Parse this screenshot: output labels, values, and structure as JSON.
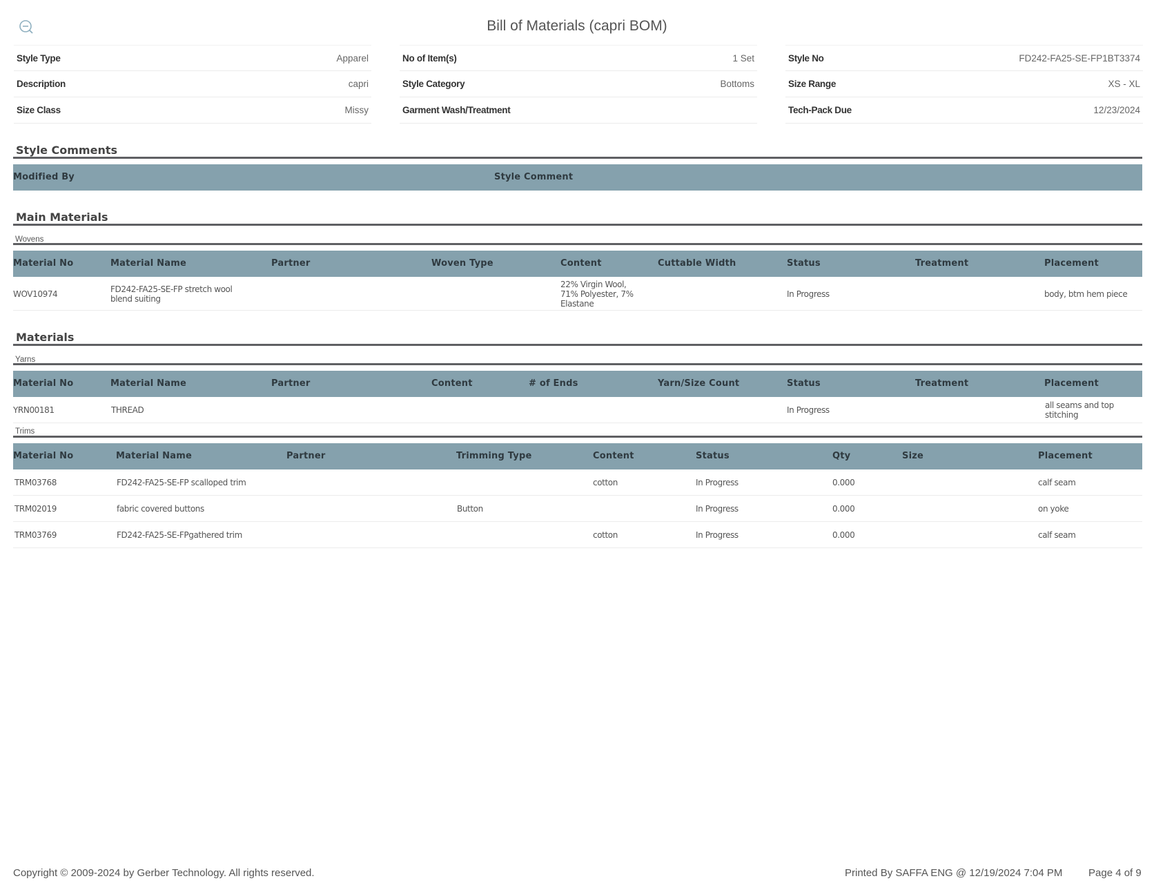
{
  "title": "Bill of Materials (capri BOM)",
  "zoom_icon": "zoom-out-icon",
  "info": [
    [
      {
        "label": "Style Type",
        "value": "Apparel"
      },
      {
        "label": "Description",
        "value": "capri"
      },
      {
        "label": "Size Class",
        "value": "Missy"
      }
    ],
    [
      {
        "label": "No of Item(s)",
        "value": "1 Set"
      },
      {
        "label": "Style Category",
        "value": "Bottoms"
      },
      {
        "label": "Garment Wash/Treatment",
        "value": ""
      }
    ],
    [
      {
        "label": "Style No",
        "value": "FD242-FA25-SE-FP1BT3374"
      },
      {
        "label": "Size Range",
        "value": "XS - XL"
      },
      {
        "label": "Tech-Pack Due",
        "value": "12/23/2024"
      }
    ]
  ],
  "style_comments": {
    "title": "Style Comments",
    "headers": [
      "Modified By",
      "Style Comment"
    ]
  },
  "main_materials": {
    "title": "Main Materials",
    "subtitle": "Wovens",
    "headers": [
      "Material No",
      "Material Name",
      "Partner",
      "Woven Type",
      "Content",
      "Cuttable Width",
      "Status",
      "Treatment",
      "Placement"
    ],
    "rows": [
      [
        "WOV10974",
        "FD242-FA25-SE-FP stretch wool blend suiting",
        "",
        "",
        "22% Virgin Wool, 71% Polyester, 7% Elastane",
        "",
        "In Progress",
        "",
        "body, btm hem piece"
      ]
    ]
  },
  "materials": {
    "title": "Materials",
    "yarns": {
      "subtitle": "Yarns",
      "headers": [
        "Material No",
        "Material Name",
        "Partner",
        "Content",
        "# of Ends",
        "Yarn/Size Count",
        "Status",
        "Treatment",
        "Placement"
      ],
      "rows": [
        [
          "YRN00181",
          "THREAD",
          "",
          "",
          "",
          "",
          "In Progress",
          "",
          "all seams and top stitching"
        ]
      ]
    },
    "trims": {
      "subtitle": "Trims",
      "headers": [
        "Material No",
        "Material Name",
        "Partner",
        "Trimming Type",
        "Content",
        "Status",
        "Qty",
        "Size",
        "Placement"
      ],
      "rows": [
        [
          "TRM03768",
          "FD242-FA25-SE-FP scalloped trim",
          "",
          "",
          "cotton",
          "In Progress",
          "0.000",
          "",
          "calf seam"
        ],
        [
          "TRM02019",
          "fabric covered buttons",
          "",
          "Button",
          "",
          "In Progress",
          "0.000",
          "",
          "on yoke"
        ],
        [
          "TRM03769",
          "FD242-FA25-SE-FPgathered trim",
          "",
          "",
          "cotton",
          "In Progress",
          "0.000",
          "",
          "calf seam"
        ]
      ]
    }
  },
  "footer": {
    "copyright": "Copyright © 2009-2024 by Gerber Technology. All rights reserved.",
    "printed_by": "Printed By SAFFA ENG @ 12/19/2024 7:04 PM",
    "page": "Page 4 of 9"
  }
}
